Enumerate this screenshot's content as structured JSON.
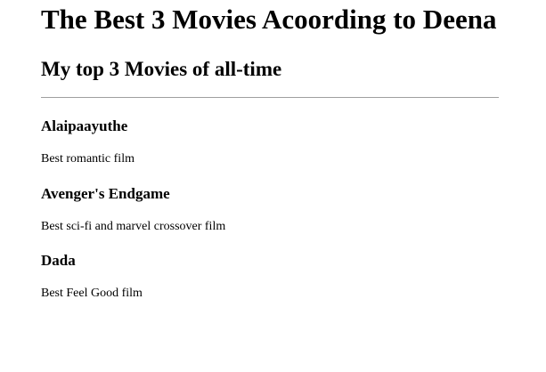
{
  "page": {
    "title": "The Best 3 Movies Acoording to Deena",
    "subtitle": "My top 3 Movies of all-time"
  },
  "movies": [
    {
      "title": "Alaipaayuthe",
      "description": "Best romantic film"
    },
    {
      "title": "Avenger's Endgame",
      "description": "Best sci-fi and marvel crossover film"
    },
    {
      "title": "Dada",
      "description": "Best Feel Good film"
    }
  ]
}
